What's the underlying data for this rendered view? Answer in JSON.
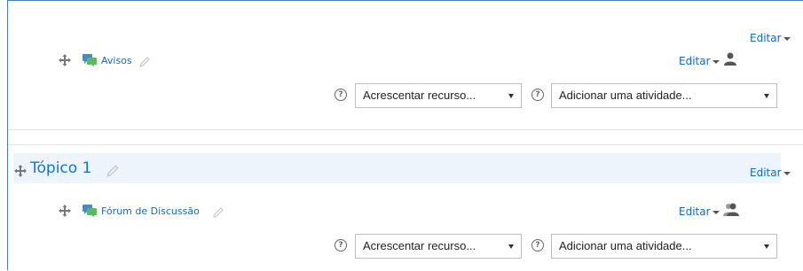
{
  "section_general": {
    "edit_label": "Editar",
    "activity": {
      "name": "Avisos",
      "edit_label": "Editar"
    },
    "add_resource": "Acrescentar recurso...",
    "add_activity": "Adicionar uma atividade..."
  },
  "section_topic1": {
    "title": "Tópico 1",
    "edit_label": "Editar",
    "activity": {
      "name": "Fórum de Discussão",
      "edit_label": "Editar"
    },
    "add_resource": "Acrescentar recurso...",
    "add_activity": "Adicionar uma atividade..."
  },
  "icons": {
    "help": "?",
    "accent_color": "#0f6cbf",
    "title_color": "#1177d1"
  }
}
